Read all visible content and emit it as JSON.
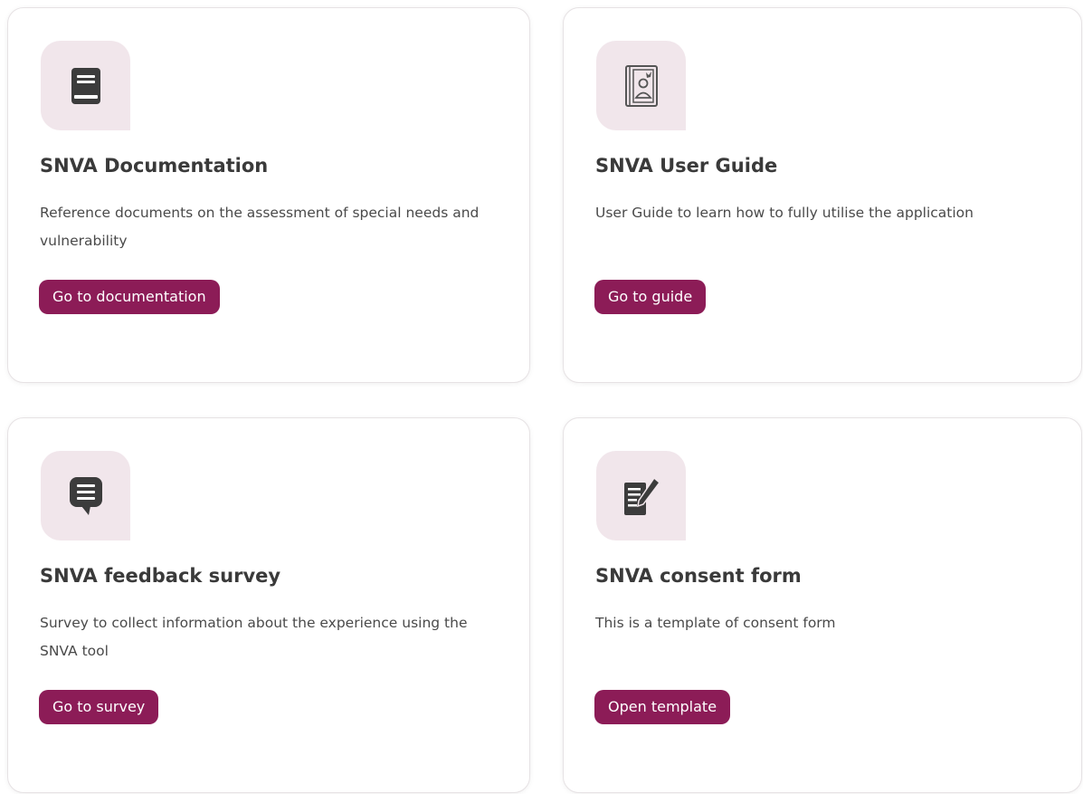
{
  "accent_color": "#8c1c57",
  "icon_bg_color": "#f1e6eb",
  "cards": [
    {
      "icon": "book-icon",
      "title": "SNVA Documentation",
      "description": "Reference documents on the assessment of special needs and vulnerability",
      "button_label": "Go to documentation"
    },
    {
      "icon": "user-guide-book-icon",
      "title": "SNVA User Guide",
      "description": "User Guide to learn how to fully utilise the application",
      "button_label": "Go to guide"
    },
    {
      "icon": "speech-bubble-icon",
      "title": "SNVA feedback survey",
      "description": "Survey to collect information about the experience using the SNVA tool",
      "button_label": "Go to survey"
    },
    {
      "icon": "form-edit-icon",
      "title": "SNVA consent form",
      "description": "This is a template of consent form",
      "button_label": "Open template"
    }
  ]
}
